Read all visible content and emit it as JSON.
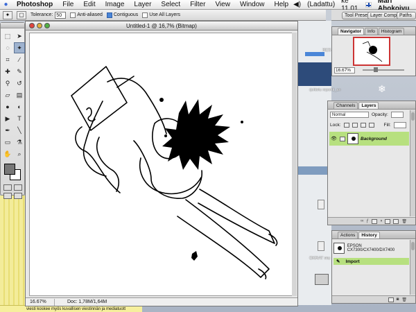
{
  "menubar": {
    "items": [
      "Photoshop",
      "File",
      "Edit",
      "Image",
      "Layer",
      "Select",
      "Filter",
      "View",
      "Window",
      "Help"
    ],
    "status": "(Ladattu)",
    "clock": "ke 11.01",
    "user": "Mari Ahokoivu"
  },
  "options": {
    "tolerance_label": "Tolerance:",
    "tolerance_value": "50",
    "anti_aliased": "Anti-aliased",
    "contiguous": "Contiguous",
    "use_all_layers": "Use All Layers"
  },
  "well": {
    "tab1": "Tool Presets",
    "tab2": "Layer Comps",
    "tab3": "Paths"
  },
  "document": {
    "title": "Untitled-1 @ 16,7% (Bitmap)",
    "zoom": "16.67%",
    "doc_info": "Doc: 1,78M/1,64M"
  },
  "navigator": {
    "tabs": [
      "Navigator",
      "Info",
      "Histogram"
    ],
    "zoom": "16.67%"
  },
  "layers": {
    "tabs": [
      "Channels",
      "Layers"
    ],
    "blend_mode": "Normal",
    "opacity_label": "Opacity:",
    "lock_label": "Lock:",
    "fill_label": "Fill:",
    "layer_name": "Background"
  },
  "history": {
    "tabs": [
      "Actions",
      "History"
    ],
    "snapshot": "EPSON CX7300/CX7400/DX7400",
    "step": "Import"
  },
  "desktop": {
    "label1": "RES",
    "label2": "rjoittelu raportti_an",
    "label3": "OKRAT mu",
    "note": "viesti koskee myös kuvallisen viestinnän ja mediatuott"
  },
  "colors": {
    "selected_row": "#b7e07f",
    "nav_frame": "#cc3333"
  }
}
